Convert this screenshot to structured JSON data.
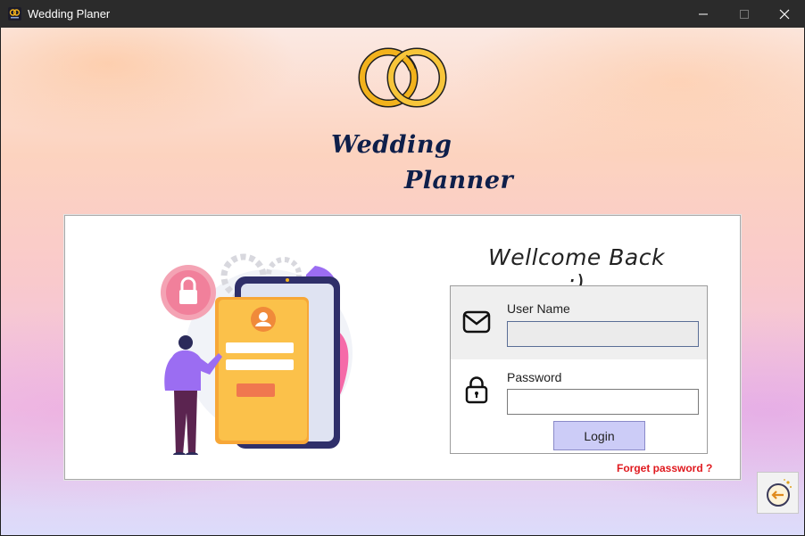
{
  "window": {
    "title": "Wedding Planer",
    "controls": [
      "minimize-icon",
      "maximize-icon",
      "close-icon"
    ]
  },
  "logo": {
    "line1": "Wedding",
    "line2": "Planner",
    "icon": "wedding-rings-icon"
  },
  "login": {
    "welcome": "Wellcome Back :)",
    "username_label": "User Name",
    "username_value": "",
    "password_label": "Password",
    "password_value": "",
    "login_button": "Login",
    "forgot_link": "Forget password ?",
    "user_icon": "mail-icon",
    "password_icon": "lock-icon"
  },
  "back_button": {
    "icon": "back-arrow-icon"
  },
  "colors": {
    "titlebar": "#2b2b2b",
    "login_button": "#ccccf7",
    "forgot_link": "#e0191e",
    "logo_text": "#0e1f4a",
    "rings": "#f2b21c"
  }
}
